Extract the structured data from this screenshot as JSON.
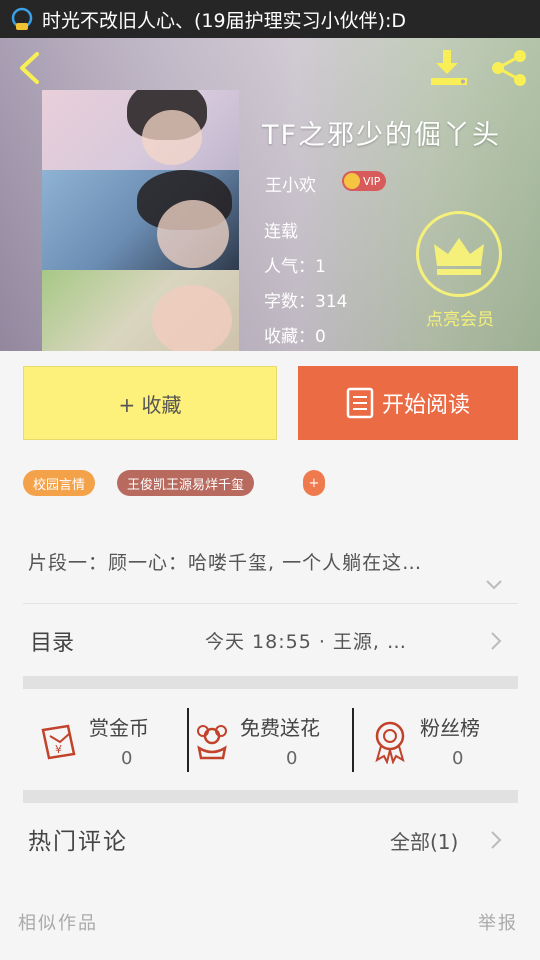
{
  "status_bar": {
    "notification_text": "时光不改旧人心、(19届护理实习小伙伴):D"
  },
  "book": {
    "title": "TF之邪少的倔丫头",
    "author": "王小欢",
    "vip_label": "VIP",
    "status": "连载",
    "popularity": "人气：1",
    "word_count": "字数：314",
    "favorites": "收藏：0",
    "member_label": "点亮会员"
  },
  "actions": {
    "collect_label": "+ 收藏",
    "read_label": "开始阅读"
  },
  "tags": [
    {
      "label": "校园言情",
      "color": "#f3a24a"
    },
    {
      "label": "王俊凯王源易烊千玺",
      "color": "#b86a5e"
    },
    {
      "label": "+",
      "color": "#ee7a4e"
    }
  ],
  "excerpt": "片段一：顾一心：哈喽千玺, 一个人躺在这…",
  "toc": {
    "label": "目录",
    "latest": "今天 18:55 · 王源, …"
  },
  "stats": [
    {
      "label": "赏金币",
      "value": "0",
      "icon": "red-envelope-icon"
    },
    {
      "label": "免费送花",
      "value": "0",
      "icon": "flower-icon"
    },
    {
      "label": "粉丝榜",
      "value": "0",
      "icon": "medal-icon"
    }
  ],
  "comments": {
    "label": "热门评论",
    "all_label": "全部(1)"
  },
  "footer": {
    "similar_label": "相似作品",
    "report_label": "举报"
  },
  "colors": {
    "accent_orange": "#eb6b44",
    "collect_yellow": "#fdf07b",
    "member_yellow": "#f5f07a"
  }
}
